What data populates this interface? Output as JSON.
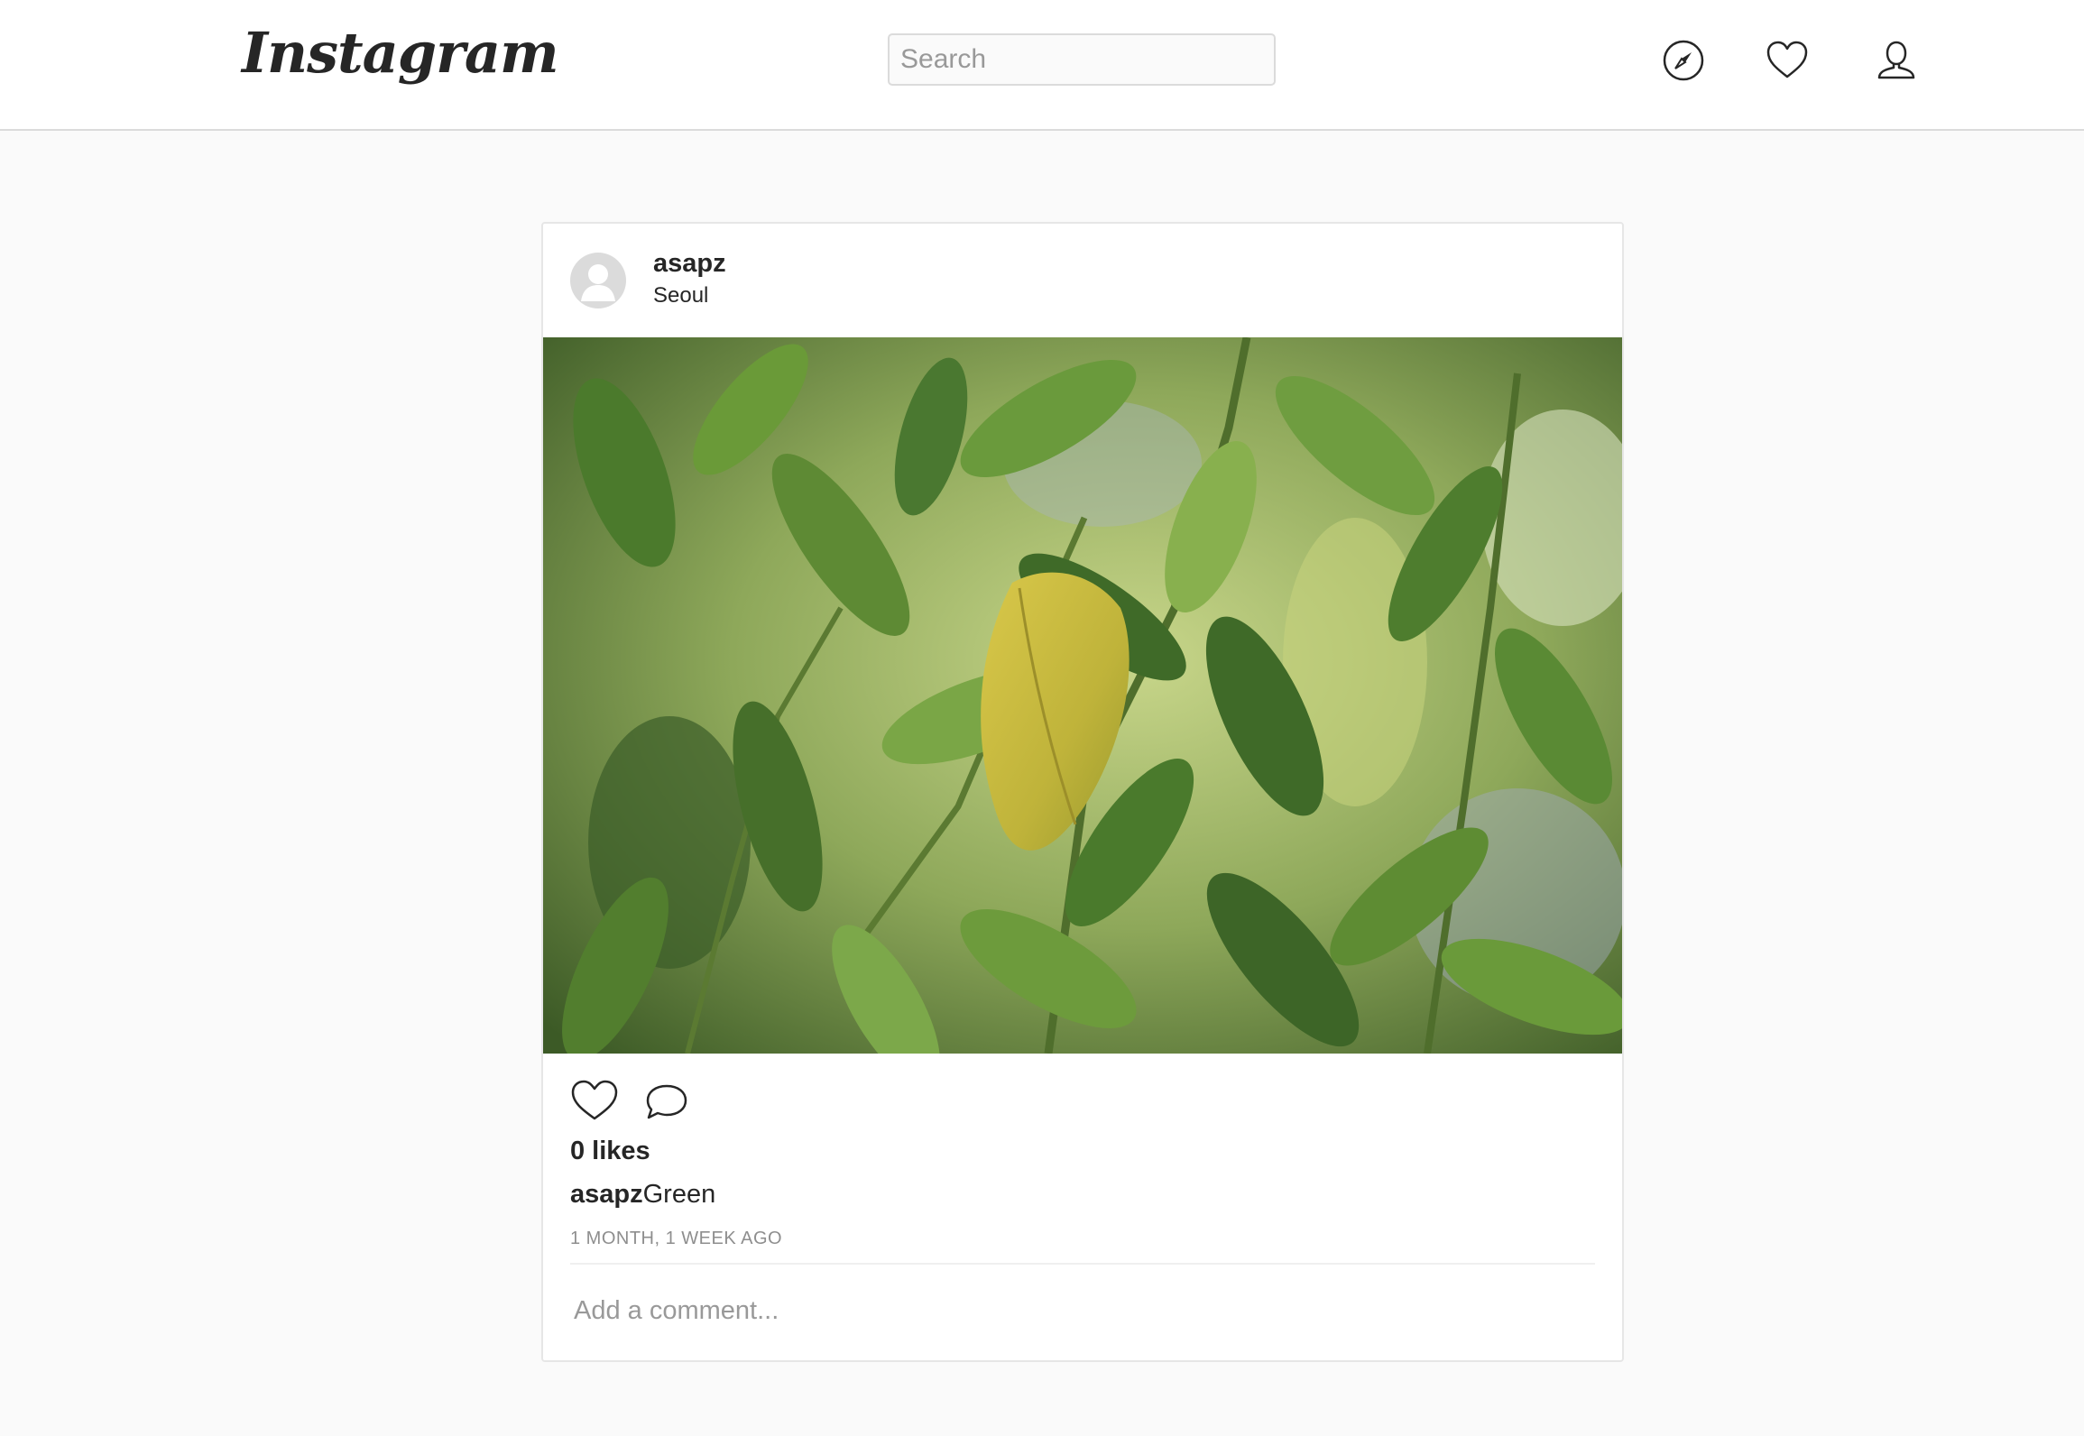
{
  "header": {
    "logo_text": "Instagram",
    "search_placeholder": "Search",
    "icons": [
      "compass-icon",
      "heart-icon",
      "user-icon"
    ]
  },
  "post": {
    "username": "asapz",
    "location": "Seoul",
    "likes_text": "0 likes",
    "caption_user": "asapz",
    "caption_text": "Green",
    "timestamp": "1 MONTH, 1 WEEK AGO",
    "comment_placeholder": "Add a comment...",
    "action_icons": [
      "heart-icon",
      "comment-bubble-icon"
    ]
  },
  "colors": {
    "page_bg": "#fafafa",
    "border": "#dbdbdb",
    "text": "#262626",
    "muted": "#8e8e8e"
  }
}
